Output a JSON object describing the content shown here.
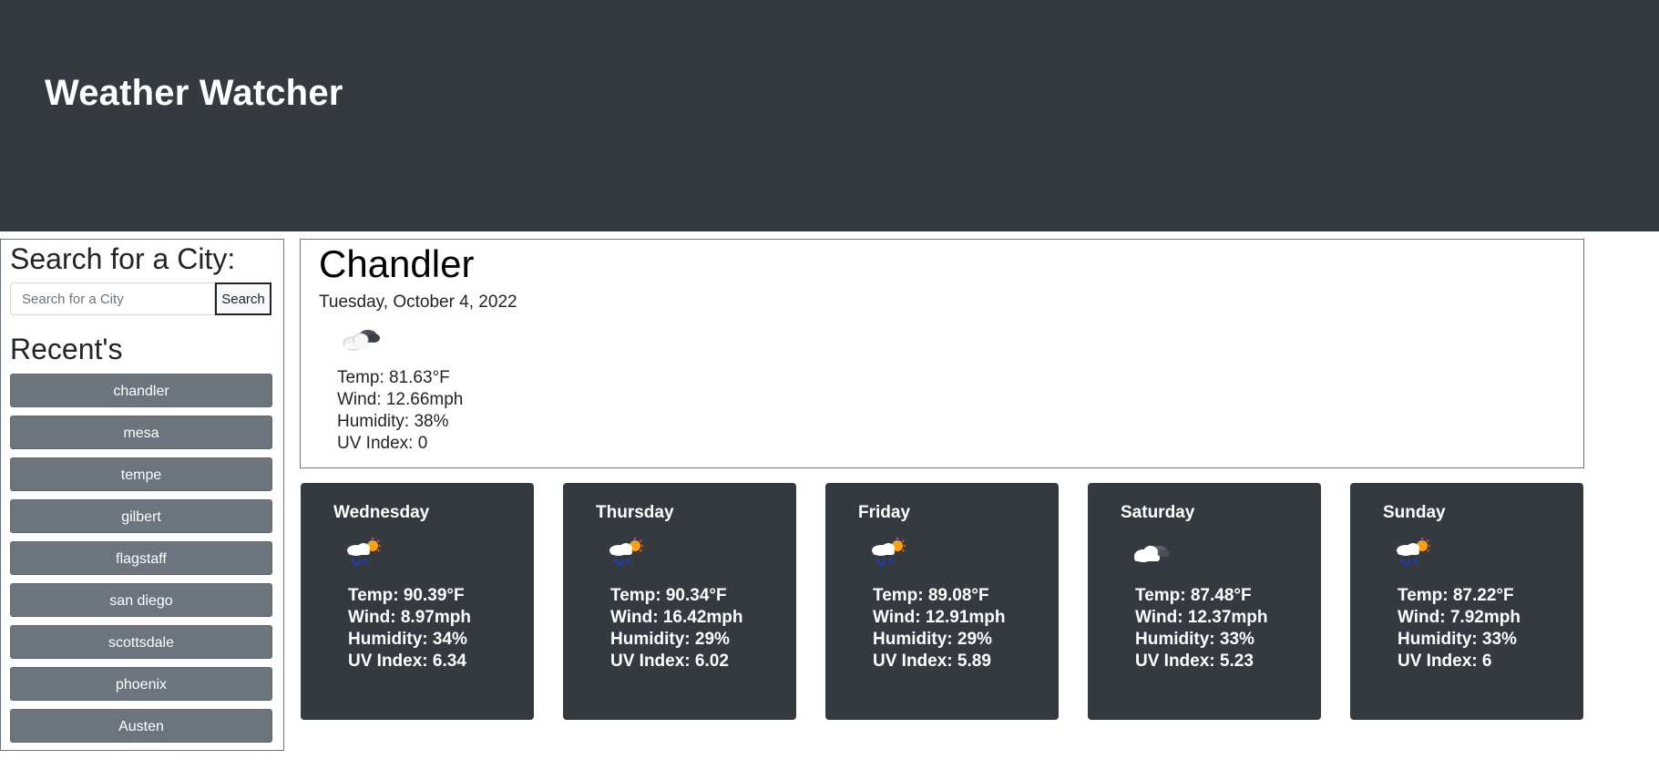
{
  "header": {
    "title": "Weather Watcher"
  },
  "sidebar": {
    "search_title": "Search for a City:",
    "search_placeholder": "Search for a City",
    "search_button": "Search",
    "recent_title": "Recent's",
    "recent_items": [
      "chandler",
      "mesa",
      "tempe",
      "gilbert",
      "flagstaff",
      "san diego",
      "scottsdale",
      "phoenix",
      "Austen"
    ]
  },
  "current": {
    "city": "Chandler",
    "date": "Tuesday, October 4, 2022",
    "icon": "clouds-icon",
    "temp": "Temp: 81.63°F",
    "wind": "Wind: 12.66mph",
    "humidity": "Humidity: 38%",
    "uv": "UV Index: 0"
  },
  "forecast": [
    {
      "day": "Wednesday",
      "icon": "rain-sun-icon",
      "temp": "Temp: 90.39°F",
      "wind": "Wind: 8.97mph",
      "humidity": "Humidity: 34%",
      "uv": "UV Index: 6.34"
    },
    {
      "day": "Thursday",
      "icon": "rain-sun-icon",
      "temp": "Temp: 90.34°F",
      "wind": "Wind: 16.42mph",
      "humidity": "Humidity: 29%",
      "uv": "UV Index: 6.02"
    },
    {
      "day": "Friday",
      "icon": "rain-sun-icon",
      "temp": "Temp: 89.08°F",
      "wind": "Wind: 12.91mph",
      "humidity": "Humidity: 29%",
      "uv": "UV Index: 5.89"
    },
    {
      "day": "Saturday",
      "icon": "clouds-icon",
      "temp": "Temp: 87.48°F",
      "wind": "Wind: 12.37mph",
      "humidity": "Humidity: 33%",
      "uv": "UV Index: 5.23"
    },
    {
      "day": "Sunday",
      "icon": "rain-sun-icon",
      "temp": "Temp: 87.22°F",
      "wind": "Wind: 7.92mph",
      "humidity": "Humidity: 33%",
      "uv": "UV Index: 6"
    }
  ],
  "colors": {
    "header_bg": "#343a40",
    "card_bg": "#343a40",
    "recent_button_bg": "#6c757d"
  }
}
